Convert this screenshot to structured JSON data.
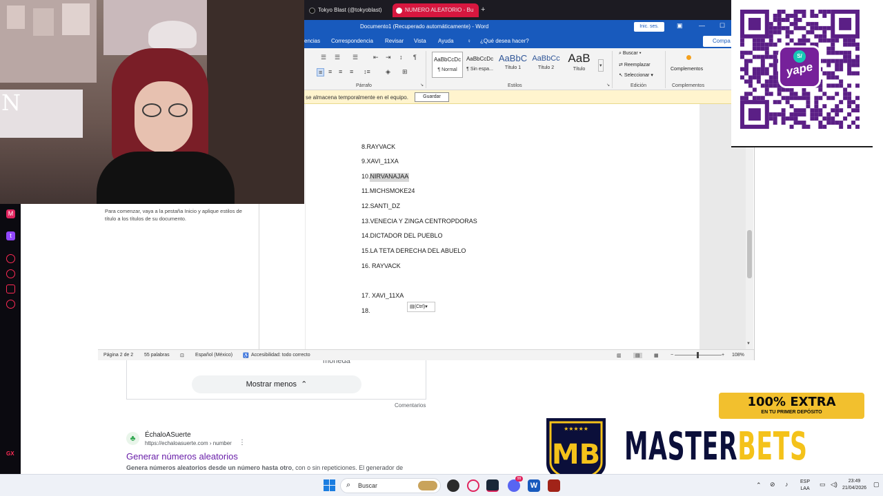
{
  "browser": {
    "tabs": [
      {
        "label": "Tokyo Blast (@tokyoblast)",
        "active": false
      },
      {
        "label": "NUMERO ALEATORIO - Bu",
        "active": true
      }
    ],
    "new_tab": "+"
  },
  "word": {
    "title": "Documento1 (Recuperado automáticamente)  -  Word",
    "signin": "Inic. ses.",
    "share": "Compa",
    "tabs": [
      "encias",
      "Correspondencia",
      "Revisar",
      "Vista",
      "Ayuda",
      "¿Qué desea hacer?"
    ],
    "styles": [
      {
        "sample": "AaBbCcDc",
        "name": "¶ Normal"
      },
      {
        "sample": "AaBbCcDc",
        "name": "¶ Sin espa..."
      },
      {
        "sample": "AaBbC",
        "name": "Título 1"
      },
      {
        "sample": "AaBbCc",
        "name": "Título 2"
      },
      {
        "sample": "AaB",
        "name": "Título"
      }
    ],
    "groups": {
      "paragraph": "Párrafo",
      "styles": "Estilos",
      "editing": "Edición",
      "addins": "Complementos"
    },
    "editing": {
      "find": "Buscar",
      "replace": "Reemplazar",
      "select": "Seleccionar"
    },
    "addins_button": "Complementos",
    "infobar": {
      "text": "se almacena temporalmente en el equipo.",
      "save": "Guardar"
    },
    "nav_hint": "Para comenzar, vaya a la pestaña Inicio y aplique estilos de título a los títulos de su documento.",
    "document_lines": [
      "8.RAYVACK",
      "9.XAVI_11XA",
      "10.NIRVANAJAA",
      "11.MICHSMOKE24",
      "12.SANTI_DZ",
      "13.VENECIA Y ZINGA CENTROPDORAS",
      "14.DICTADOR DEL PUEBLO",
      "15.LA TETA DERECHA DEL ABUELO",
      "16. RAYVACK",
      "17. XAVI_11XA",
      "18."
    ],
    "paste_chip": "(Ctrl)",
    "status": {
      "page": "Página 2 de 2",
      "words": "55 palabras",
      "language": "Español (México)",
      "accessibility": "Accesibilidad: todo correcto",
      "zoom": "108%"
    }
  },
  "search_page": {
    "moneda": "moneda",
    "show_less": "Mostrar menos",
    "comments": "Comentarios",
    "result": {
      "site": "ÉchaloASuerte",
      "url": "https://echaloasuerte.com › number",
      "title": "Generar números aleatorios",
      "snippet_bold": "Genera números aleatorios desde un número hasta otro",
      "snippet_rest": ", con o sin repeticiones. El generador de"
    }
  },
  "gx": {
    "label": "GX"
  },
  "overlay": {
    "yape": "yape",
    "yape_currency": "S/",
    "extra_main": "100% EXTRA",
    "extra_sub": "EN TU PRIMER DEPÓSITO",
    "brand_master": "MASTER",
    "brand_bets": "BETS",
    "shield_letters": "MB",
    "shield_stars": "★★★★★",
    "webcam_letter": "N"
  },
  "taskbar": {
    "search": "Buscar",
    "lang_top": "ESP",
    "lang_bottom": "LAA",
    "time": "23:49",
    "date": "21/04/2026",
    "badge_count": "99"
  }
}
